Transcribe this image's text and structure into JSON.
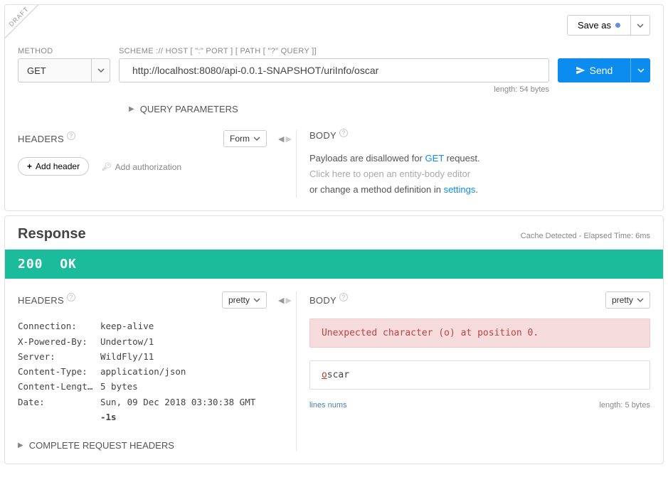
{
  "draft_label": "DRAFT",
  "toolbar": {
    "save_as": "Save as"
  },
  "request": {
    "method_label": "METHOD",
    "method_value": "GET",
    "url_label": "SCHEME :// HOST [ \":\" PORT ] [ PATH [ \"?\" QUERY ]]",
    "url_value": "http://localhost:8080/api-0.0.1-SNAPSHOT/uriInfo/oscar",
    "url_length": "length: 54 bytes",
    "send_label": "Send",
    "query_params_label": "QUERY PARAMETERS"
  },
  "req_headers": {
    "title": "HEADERS",
    "mode": "Form",
    "add_header": "Add header",
    "add_auth": "Add authorization"
  },
  "req_body": {
    "title": "BODY",
    "line1a": "Payloads are disallowed for ",
    "line1b": "GET",
    "line1c": " request.",
    "line2": "Click here to open an entity-body editor",
    "line3a": "or change a method definition in ",
    "line3b": "settings",
    "line3c": "."
  },
  "response": {
    "title": "Response",
    "meta": "Cache Detected - Elapsed Time: 6ms",
    "status_code": "200",
    "status_text": "OK"
  },
  "resp_headers": {
    "title": "HEADERS",
    "mode": "pretty",
    "items": [
      {
        "k": "Connection:",
        "v": "keep-alive"
      },
      {
        "k": "X-Powered-By:",
        "v": "Undertow/1"
      },
      {
        "k": "Server:",
        "v": "WildFly/11"
      },
      {
        "k": "Content-Type:",
        "v": "application/json"
      },
      {
        "k": "Content-Lengt…",
        "v": "5 bytes"
      },
      {
        "k": "Date:",
        "v": "Sun, 09 Dec 2018 03:30:38 GMT",
        "rel": " -1s"
      }
    ],
    "complete": "COMPLETE REQUEST HEADERS"
  },
  "resp_body": {
    "title": "BODY",
    "mode": "pretty",
    "error": "Unexpected character (o) at position 0.",
    "payload_hl": "o",
    "payload_rest": "scar",
    "lines_nums": "lines nums",
    "length": "length: 5 bytes"
  }
}
